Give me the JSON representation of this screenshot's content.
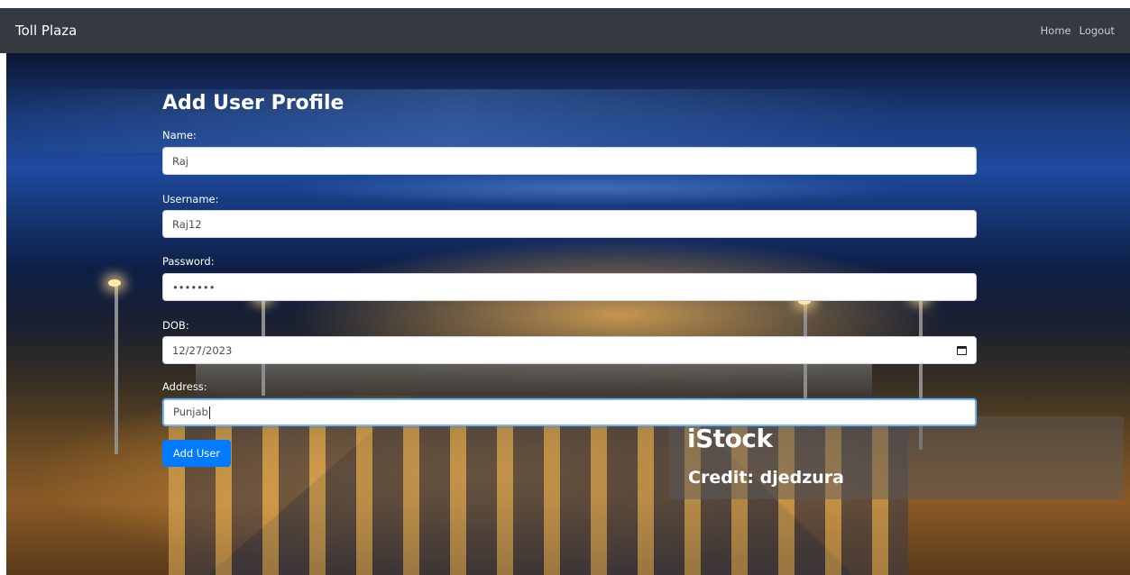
{
  "navbar": {
    "brand": "Toll Plaza",
    "links": [
      "Home",
      "Logout"
    ]
  },
  "form": {
    "title": "Add User Profile",
    "fields": [
      {
        "label": "Name:",
        "value": "Raj"
      },
      {
        "label": "Username:",
        "value": "Raj12"
      },
      {
        "label": "Password:",
        "value": "•••••••"
      },
      {
        "label": "DOB:",
        "value": "12/27/2023"
      },
      {
        "label": "Address:",
        "value": "Punjab"
      }
    ],
    "submit_label": "Add User"
  },
  "background": {
    "watermark_logo": "iStock",
    "watermark_credit": "Credit: djedzura"
  },
  "colors": {
    "navbar_bg": "#343a40",
    "button_bg": "#007bff",
    "focus_border": "#7fb4ea"
  },
  "icons": {
    "dob_picker": "calendar-icon"
  }
}
